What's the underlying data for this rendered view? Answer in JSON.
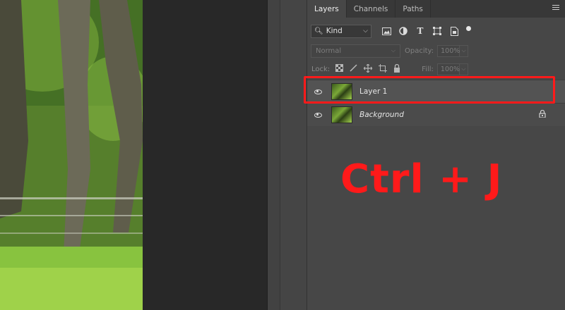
{
  "tabs": [
    {
      "label": "Layers",
      "active": true
    },
    {
      "label": "Channels",
      "active": false
    },
    {
      "label": "Paths",
      "active": false
    }
  ],
  "filter": {
    "kind_label": "Kind"
  },
  "blend": {
    "mode": "Normal",
    "opacity_label": "Opacity:",
    "opacity_value": "100%"
  },
  "lock": {
    "label": "Lock:",
    "fill_label": "Fill:",
    "fill_value": "100%"
  },
  "layers": [
    {
      "name": "Layer 1",
      "selected": true,
      "visible": true,
      "locked": false
    },
    {
      "name": "Background",
      "selected": false,
      "visible": true,
      "locked": true
    }
  ],
  "overlay": {
    "text": "Ctrl + J",
    "color": "#ff1a1a"
  },
  "colors": {
    "panel": "#474747",
    "accent": "#ff1a1a"
  }
}
